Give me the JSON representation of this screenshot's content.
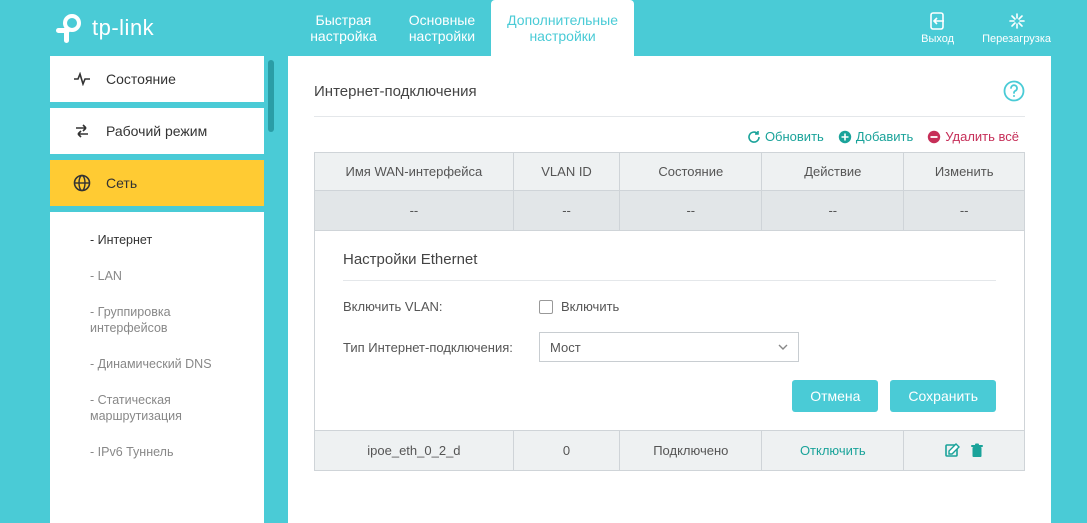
{
  "brand": "tp-link",
  "tabs": [
    {
      "label": "Быстрая\nнастройка"
    },
    {
      "label": "Основные\nнастройки"
    },
    {
      "label": "Дополнительные\nнастройки"
    }
  ],
  "topActions": {
    "logout": "Выход",
    "reboot": "Перезагрузка"
  },
  "sidebar": {
    "status": "Состояние",
    "mode": "Рабочий режим",
    "network": "Сеть",
    "sub": {
      "internet": "- Интернет",
      "lan": "- LAN",
      "if_group": "- Группировка\nинтерфейсов",
      "ddns": "- Динамический DNS",
      "static_route": "- Статическая\nмаршрутизация",
      "ipv6_tunnel": "- IPv6 Туннель"
    }
  },
  "panel": {
    "title": "Интернет-подключения",
    "actions": {
      "refresh": "Обновить",
      "add": "Добавить",
      "delete_all": "Удалить всё"
    },
    "columns": {
      "wan": "Имя WAN-интерфейса",
      "vlan": "VLAN ID",
      "state": "Состояние",
      "action": "Действие",
      "modify": "Изменить"
    },
    "placeholder_cell": "--",
    "ethernet": {
      "title": "Настройки Ethernet",
      "vlan_label": "Включить VLAN:",
      "vlan_check": "Включить",
      "conn_label": "Тип Интернет-подключения:",
      "conn_value": "Мост",
      "cancel": "Отмена",
      "save": "Сохранить"
    },
    "row": {
      "wan": "ipoe_eth_0_2_d",
      "vlan": "0",
      "state": "Подключено",
      "action": "Отключить"
    }
  }
}
